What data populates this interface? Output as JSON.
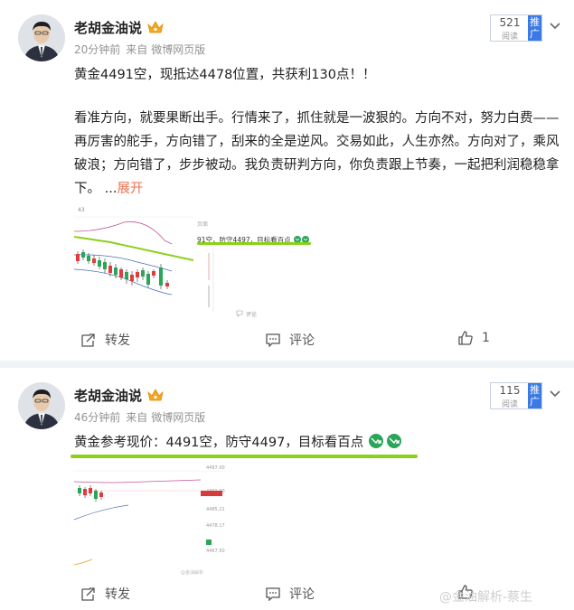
{
  "posts": [
    {
      "author": "老胡金油说",
      "time": "20分钟前",
      "source_prefix": "来自",
      "source": "微博网页版",
      "reads": "521",
      "reads_label": "阅读",
      "promote": "推广",
      "headline": "黄金4491空，现抵达4478位置，共获利130点！！",
      "body": "看准方向，就要果断出手。行情来了，抓住就是一波狠的。方向不对，努力白费——再厉害的舵手，方向错了，刮来的全是逆风。交易如此，人生亦然。方向对了，乘风破浪；方向错了，步步被动。我负责研判方向，你负责跟上节奏，一起把利润稳稳拿下。 ...",
      "expand": "展开",
      "image_snippet": "91空，防守4497，目标看百点",
      "image_top_label": "43",
      "image_caption": "评论",
      "image_text_short": "页面",
      "forward": "转发",
      "comment": "评论",
      "like_count": "1"
    },
    {
      "author": "老胡金油说",
      "time": "46分钟前",
      "source_prefix": "来自",
      "source": "微博网页版",
      "reads": "115",
      "reads_label": "阅读",
      "promote": "推广",
      "headline": "黄金参考现价：4491空，防守4497，目标看百点",
      "image_prices": [
        "4497.00",
        "4491.00",
        "4485.21",
        "4478.17",
        "4467.50"
      ],
      "image_watermark": "@金油解析",
      "forward": "转发",
      "comment": "评论"
    }
  ],
  "watermark": "@金油解析-蔡生",
  "colors": {
    "accent_orange": "#eb7350",
    "promote_blue": "#3b79e4",
    "highlight_green": "#8bd019"
  }
}
